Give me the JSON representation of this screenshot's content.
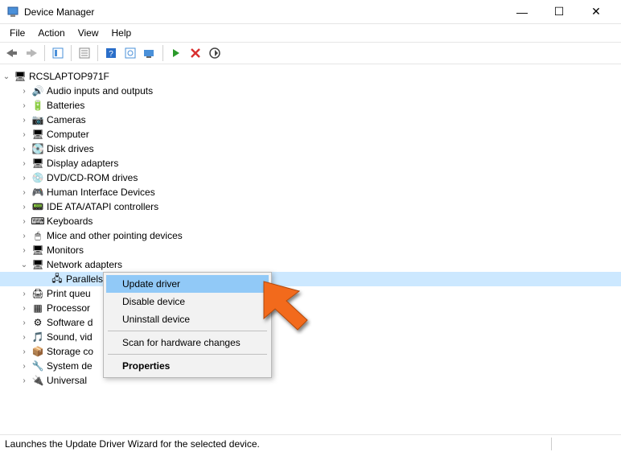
{
  "window": {
    "title": "Device Manager"
  },
  "menu": {
    "items": [
      "File",
      "Action",
      "View",
      "Help"
    ]
  },
  "tree": {
    "root": "RCSLAPTOP971F",
    "items": [
      {
        "label": "Audio inputs and outputs",
        "icon": "audio"
      },
      {
        "label": "Batteries",
        "icon": "battery"
      },
      {
        "label": "Cameras",
        "icon": "camera"
      },
      {
        "label": "Computer",
        "icon": "computer"
      },
      {
        "label": "Disk drives",
        "icon": "disk"
      },
      {
        "label": "Display adapters",
        "icon": "display"
      },
      {
        "label": "DVD/CD-ROM drives",
        "icon": "dvd"
      },
      {
        "label": "Human Interface Devices",
        "icon": "hid"
      },
      {
        "label": "IDE ATA/ATAPI controllers",
        "icon": "ide"
      },
      {
        "label": "Keyboards",
        "icon": "keyboard"
      },
      {
        "label": "Mice and other pointing devices",
        "icon": "mouse"
      },
      {
        "label": "Monitors",
        "icon": "monitor"
      },
      {
        "label": "Network adapters",
        "icon": "network",
        "expanded": true,
        "children": [
          {
            "label": "Parallels Ethernet Adapter",
            "icon": "netcard",
            "selected": true
          }
        ]
      },
      {
        "label": "Print queues",
        "icon": "printer",
        "truncated": "Print queu"
      },
      {
        "label": "Processors",
        "icon": "cpu",
        "truncated": "Processor"
      },
      {
        "label": "Software devices",
        "icon": "software",
        "truncated": "Software d"
      },
      {
        "label": "Sound, video and game controllers",
        "icon": "sound",
        "truncated": "Sound, vid"
      },
      {
        "label": "Storage controllers",
        "icon": "storage",
        "truncated": "Storage co"
      },
      {
        "label": "System devices",
        "icon": "system",
        "truncated": "System de"
      },
      {
        "label": "Universal Serial Bus controllers",
        "icon": "usb",
        "truncated": "Universal "
      }
    ]
  },
  "context_menu": {
    "items": [
      {
        "label": "Update driver",
        "highlight": true
      },
      {
        "label": "Disable device"
      },
      {
        "label": "Uninstall device"
      },
      {
        "sep": true
      },
      {
        "label": "Scan for hardware changes"
      },
      {
        "sep": true
      },
      {
        "label": "Properties",
        "bold": true
      }
    ]
  },
  "statusbar": {
    "text": "Launches the Update Driver Wizard for the selected device."
  },
  "icons": {
    "audio": "🔊",
    "battery": "🔋",
    "camera": "📷",
    "computer": "🖥",
    "disk": "💽",
    "display": "🖥",
    "dvd": "💿",
    "hid": "🎮",
    "ide": "📟",
    "keyboard": "⌨",
    "mouse": "🖱",
    "monitor": "🖥",
    "network": "🖥",
    "netcard": "🖧",
    "printer": "🖨",
    "cpu": "▦",
    "software": "⚙",
    "sound": "🎵",
    "storage": "📦",
    "system": "🔧",
    "usb": "🔌",
    "root": "🖥"
  }
}
